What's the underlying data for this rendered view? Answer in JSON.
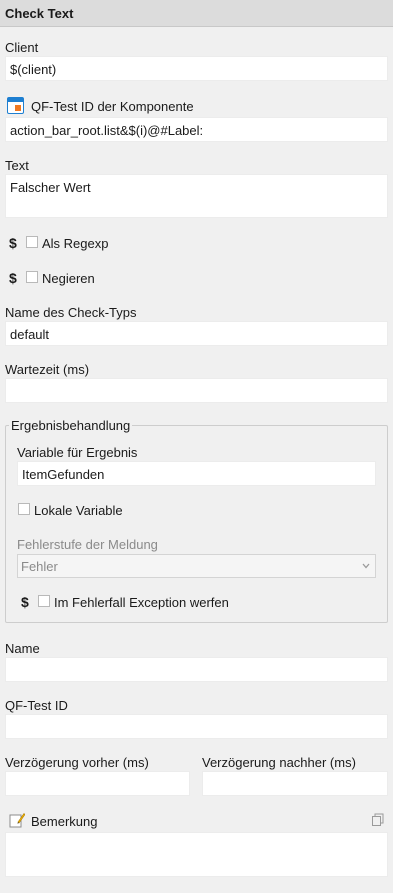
{
  "title": "Check Text",
  "client": {
    "label": "Client",
    "value": "$(client)"
  },
  "component": {
    "label": "QF-Test ID der Komponente",
    "value": "action_bar_root.list&$(i)@#Label:",
    "icon": "component-icon"
  },
  "text": {
    "label": "Text",
    "value": "Falscher Wert"
  },
  "regexp": {
    "symbol": "$",
    "label": "Als Regexp",
    "checked": false
  },
  "negate": {
    "symbol": "$",
    "label": "Negieren",
    "checked": false
  },
  "check_type": {
    "label": "Name des Check-Typs",
    "value": "default"
  },
  "wait_time": {
    "label": "Wartezeit (ms)",
    "value": ""
  },
  "result_group": {
    "title": "Ergebnisbehandlung",
    "variable": {
      "label": "Variable für Ergebnis",
      "value": "ItemGefunden"
    },
    "local_variable": {
      "label": "Lokale Variable",
      "checked": false
    },
    "error_level": {
      "label": "Fehlerstufe der Meldung",
      "selected": "Fehler"
    },
    "exception": {
      "symbol": "$",
      "label": "Im Fehlerfall Exception werfen",
      "checked": false
    }
  },
  "name": {
    "label": "Name",
    "value": ""
  },
  "qftest_id": {
    "label": "QF-Test ID",
    "value": ""
  },
  "delay_before": {
    "label": "Verzögerung vorher (ms)",
    "value": ""
  },
  "delay_after": {
    "label": "Verzögerung nachher (ms)",
    "value": ""
  },
  "comment": {
    "label": "Bemerkung",
    "value": "",
    "icon": "note-pencil-icon",
    "action_icon": "copy-icon"
  }
}
